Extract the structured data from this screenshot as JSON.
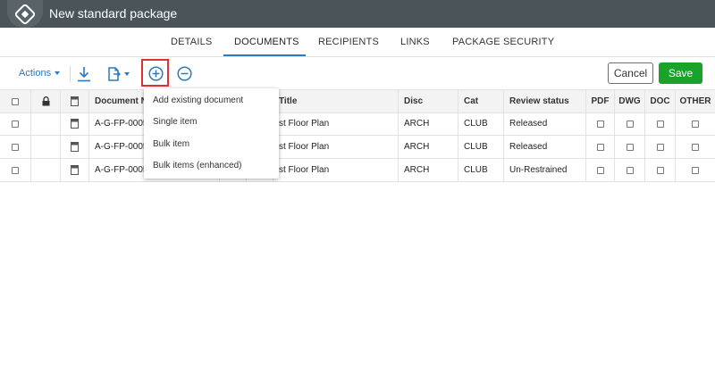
{
  "window": {
    "title": "New standard package"
  },
  "tabs": [
    {
      "label": "DETAILS"
    },
    {
      "label": "DOCUMENTS"
    },
    {
      "label": "RECIPIENTS"
    },
    {
      "label": "LINKS"
    },
    {
      "label": "PACKAGE SECURITY"
    }
  ],
  "active_tab": "DOCUMENTS",
  "toolbar": {
    "actions_label": "Actions",
    "icons": [
      "download-icon",
      "document-export-icon",
      "add-circle-icon",
      "remove-circle-icon"
    ],
    "cancel_label": "Cancel",
    "save_label": "Save"
  },
  "colors": {
    "accent": "#2a7abf",
    "save": "#1aa32a",
    "titlebar": "#4b5459",
    "highlight": "#e03030"
  },
  "table": {
    "headers": {
      "select": "",
      "lock": "",
      "type": "",
      "doc_number": "Document N",
      "title": "Title",
      "disc": "Disc",
      "cat": "Cat",
      "review_status": "Review status",
      "pdf": "PDF",
      "dwg": "DWG",
      "doc": "DOC",
      "other": "OTHER"
    },
    "rows": [
      {
        "doc_number": "A-G-FP-0005",
        "title": "st Floor Plan",
        "disc": "ARCH",
        "cat": "CLUB",
        "review_status": "Released"
      },
      {
        "doc_number": "A-G-FP-0005",
        "title": "st Floor Plan",
        "disc": "ARCH",
        "cat": "CLUB",
        "review_status": "Released"
      },
      {
        "doc_number": "A-G-FP-0005",
        "title": "st Floor Plan",
        "disc": "ARCH",
        "cat": "CLUB",
        "review_status": "Un-Restrained"
      }
    ]
  },
  "add_menu": {
    "items": [
      {
        "label": "Add existing document"
      },
      {
        "label": "Single item"
      },
      {
        "label": "Bulk item"
      },
      {
        "label": "Bulk items (enhanced)"
      }
    ]
  }
}
